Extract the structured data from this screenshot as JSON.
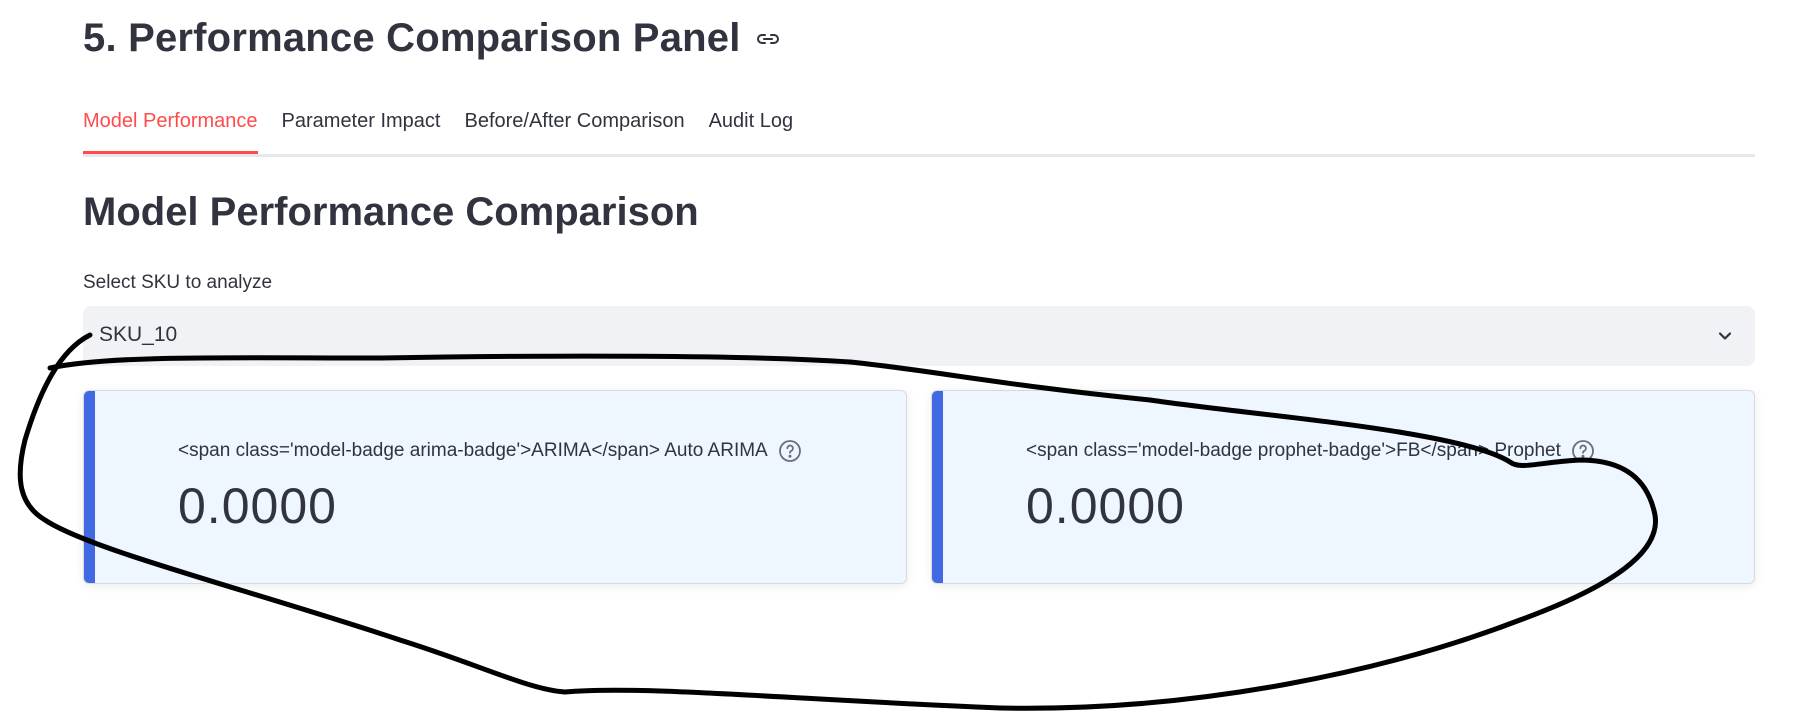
{
  "section": {
    "title": "5. Performance Comparison Panel",
    "link_icon": "link-icon"
  },
  "tabs": [
    {
      "label": "Model Performance",
      "active": true
    },
    {
      "label": "Parameter Impact",
      "active": false
    },
    {
      "label": "Before/After Comparison",
      "active": false
    },
    {
      "label": "Audit Log",
      "active": false
    }
  ],
  "main": {
    "heading": "Model Performance Comparison",
    "sku_select": {
      "label": "Select SKU to analyze",
      "value": "SKU_10",
      "icon": "chevron-down-icon"
    },
    "metrics": [
      {
        "label": "<span class='model-badge arima-badge'>ARIMA</span> Auto ARIMA",
        "value": "0.0000",
        "help_icon": "help-circle-icon"
      },
      {
        "label": "<span class='model-badge prophet-badge'>FB</span> Prophet",
        "value": "0.0000",
        "help_icon": "help-circle-icon"
      }
    ]
  },
  "colors": {
    "accent": "#ff4b4b",
    "text": "#31333f",
    "card_bar": "#4169e1",
    "card_bg": "#eef6ff",
    "select_bg": "#f0f2f6",
    "annotation_stroke": "#000000"
  }
}
